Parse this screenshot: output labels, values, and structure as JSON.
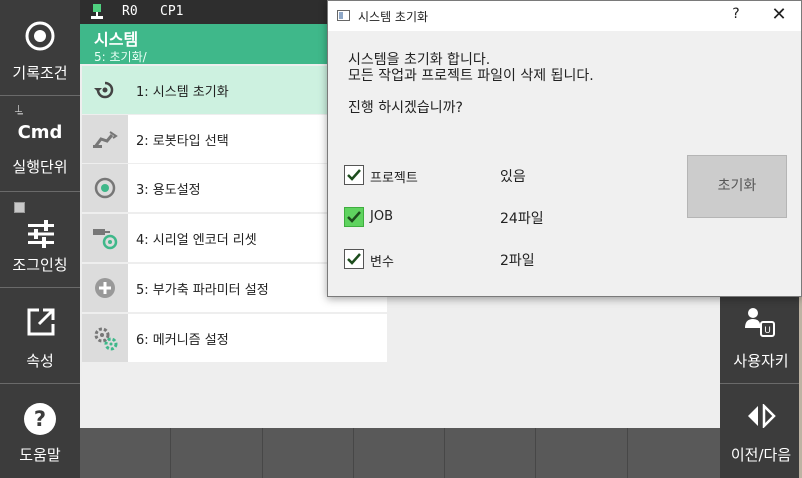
{
  "left_sidebar": {
    "record_condition": "기록조건",
    "cmd": "Cmd",
    "exec_unit": "실행단위",
    "jog_inching": "조그인칭",
    "speed": "속성",
    "help": "도움말"
  },
  "status_bar": {
    "r0": "R0",
    "cp1": "CP1"
  },
  "header": {
    "title": "시스템",
    "crumb": "5: 초기화/"
  },
  "menu": {
    "items": [
      {
        "label": "1: 시스템 초기화"
      },
      {
        "label": "2: 로봇타입 선택"
      },
      {
        "label": "3: 용도설정"
      },
      {
        "label": "4: 시리얼 엔코더 리셋"
      },
      {
        "label": "5: 부가축 파라미터 설정"
      },
      {
        "label": "6: 메커니즘 설정"
      }
    ]
  },
  "right_panel": {
    "user_key": "사용자키",
    "prev_next": "이전/다음"
  },
  "dialog": {
    "title": "시스템 초기화",
    "help_glyph": "?",
    "close_glyph": "✕",
    "line1": "시스템을 초기화 합니다.",
    "line2": "모든 작업과 프로젝트 파일이 삭제 됩니다.",
    "question": "진행 하시겠습니까?",
    "options": [
      {
        "label": "프로젝트",
        "value": "있음",
        "checked": true
      },
      {
        "label": "JOB",
        "value": "24파일",
        "checked": true
      },
      {
        "label": "변수",
        "value": "2파일",
        "checked": true
      }
    ],
    "init_button": "초기화"
  },
  "colors": {
    "accent_green": "#3fb88a",
    "selected_row": "#cdf1e0",
    "sidebar_bg": "#3c3c3c",
    "checkbox_highlight": "#5fd35f"
  }
}
